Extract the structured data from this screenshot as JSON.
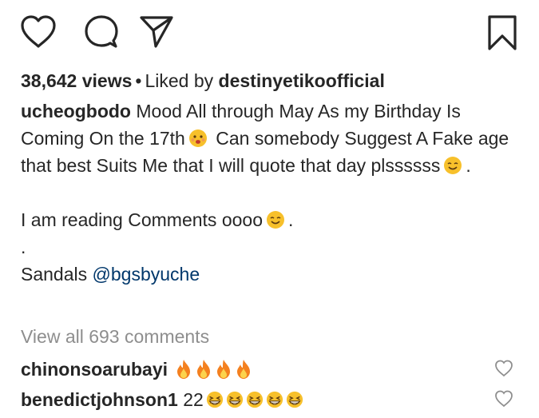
{
  "icons": {
    "like": "heart-icon",
    "comment": "comment-icon",
    "share": "paper-plane-icon",
    "save": "bookmark-icon"
  },
  "stats": {
    "views": "38,642 views",
    "separator": "•",
    "liked_by_prefix": "Liked by",
    "liked_by_user": "destinyetikoofficial"
  },
  "caption": {
    "username": "ucheogbodo",
    "line1": "Mood All through May As my Birthday Is Coming On the 17th",
    "line1b": "Can somebody Suggest A Fake age that best Suits Me that I will quote that day plssssss",
    "line1_end": ".",
    "line2": "I am reading Comments oooo",
    "line2_end": ".",
    "dot_line": ".",
    "sandals_prefix": "Sandals",
    "mention": "@bgsbyuche"
  },
  "comments_link": "View all 693 comments",
  "comments": [
    {
      "username": "chinonsoarubayi",
      "text": "",
      "emoji": "fire-emoji",
      "emoji_count": 4
    },
    {
      "username": "benedictjohnson1",
      "text": "22",
      "emoji": "grinning-squint-emoji",
      "emoji_count": 5
    }
  ],
  "colors": {
    "text": "#262626",
    "muted": "#8e8e8e",
    "link": "#00376b",
    "emoji_yellow": "#f7c02b",
    "fire_orange": "#f4801f"
  }
}
